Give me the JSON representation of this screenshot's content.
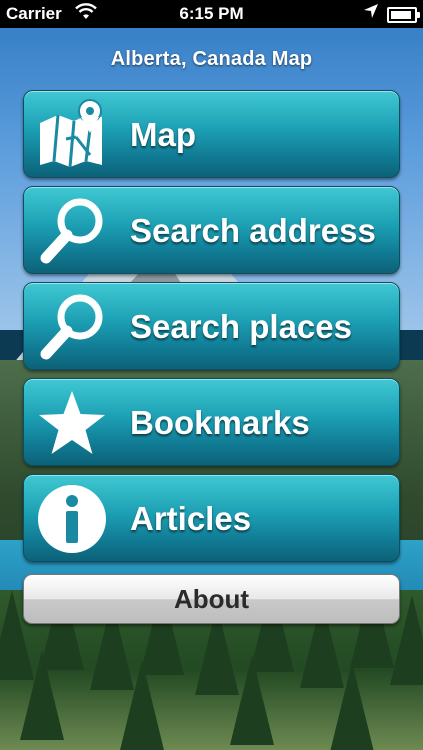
{
  "status_bar": {
    "carrier": "Carrier",
    "wifi_icon": "wifi-icon",
    "time": "6:15 PM",
    "location_icon": "location-arrow-icon",
    "battery_icon": "battery-icon",
    "battery_level": 0.9
  },
  "header": {
    "title": "Alberta, Canada Map"
  },
  "menu": {
    "items": [
      {
        "label": "Map",
        "icon": "map-pin-icon"
      },
      {
        "label": "Search address",
        "icon": "magnifier-icon"
      },
      {
        "label": "Search places",
        "icon": "magnifier-icon"
      },
      {
        "label": "Bookmarks",
        "icon": "star-icon"
      },
      {
        "label": "Articles",
        "icon": "info-icon"
      }
    ],
    "about_label": "About"
  },
  "colors": {
    "button_top": "#40c8d3",
    "button_bottom": "#0c6278",
    "about_button": "#e8e8e8"
  }
}
